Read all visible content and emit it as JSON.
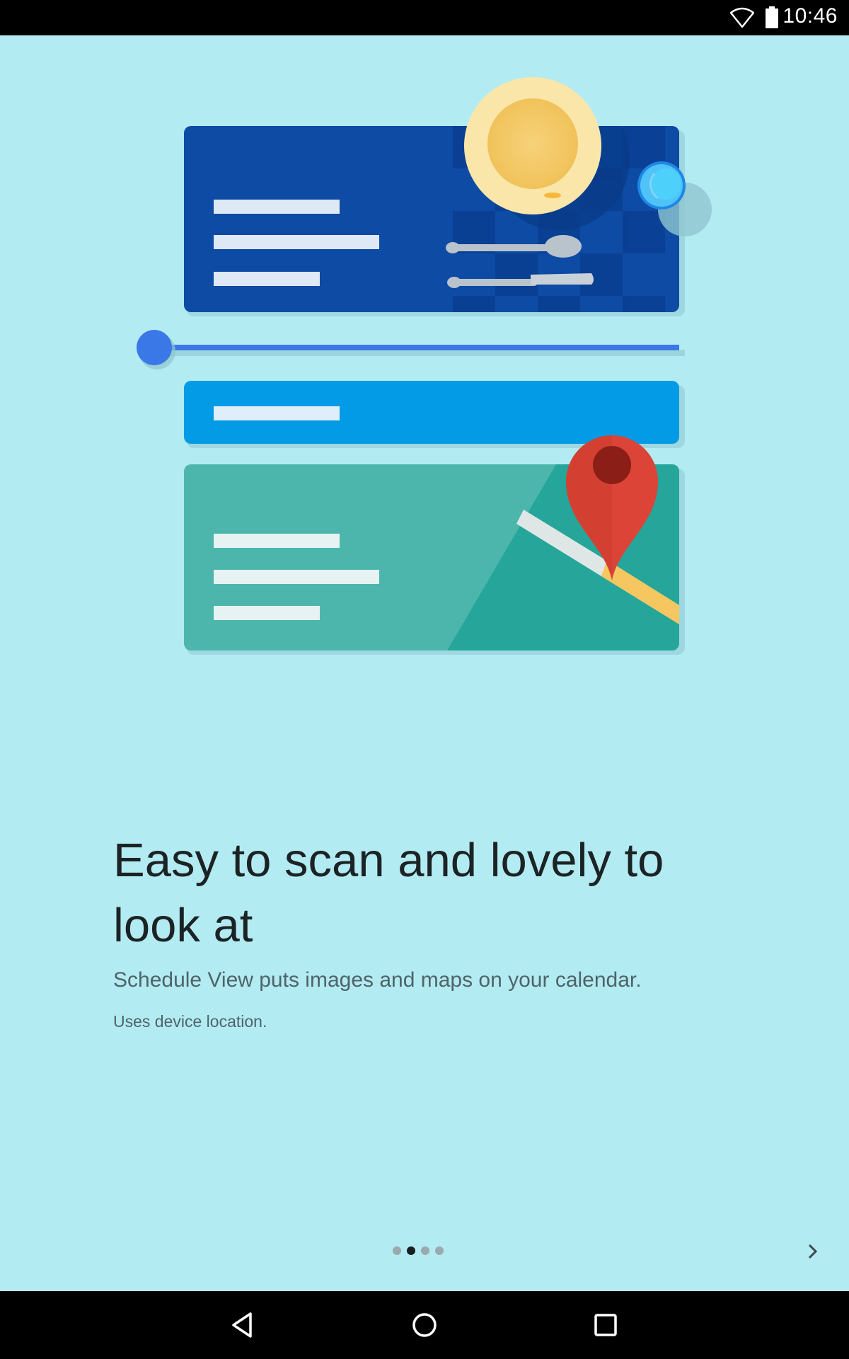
{
  "status_bar": {
    "time": "10:46",
    "icons": [
      "wifi-icon",
      "battery-icon"
    ]
  },
  "onboarding": {
    "headline": "Easy to scan and lovely to look at",
    "subtitle": "Schedule View puts images and maps on your calendar.",
    "note": "Uses device location.",
    "page_count": 4,
    "active_page": 2
  },
  "navigation": {
    "next_icon": "chevron-right-icon",
    "system_buttons": [
      "back-icon",
      "home-icon",
      "recents-icon"
    ]
  },
  "colors": {
    "background": "#b3ebf2",
    "card_dark_blue": "#0d4ba5",
    "card_light_blue": "#039be5",
    "card_teal": "#4db6ac",
    "map_pin": "#db4437",
    "timeline": "#3b78e7"
  }
}
